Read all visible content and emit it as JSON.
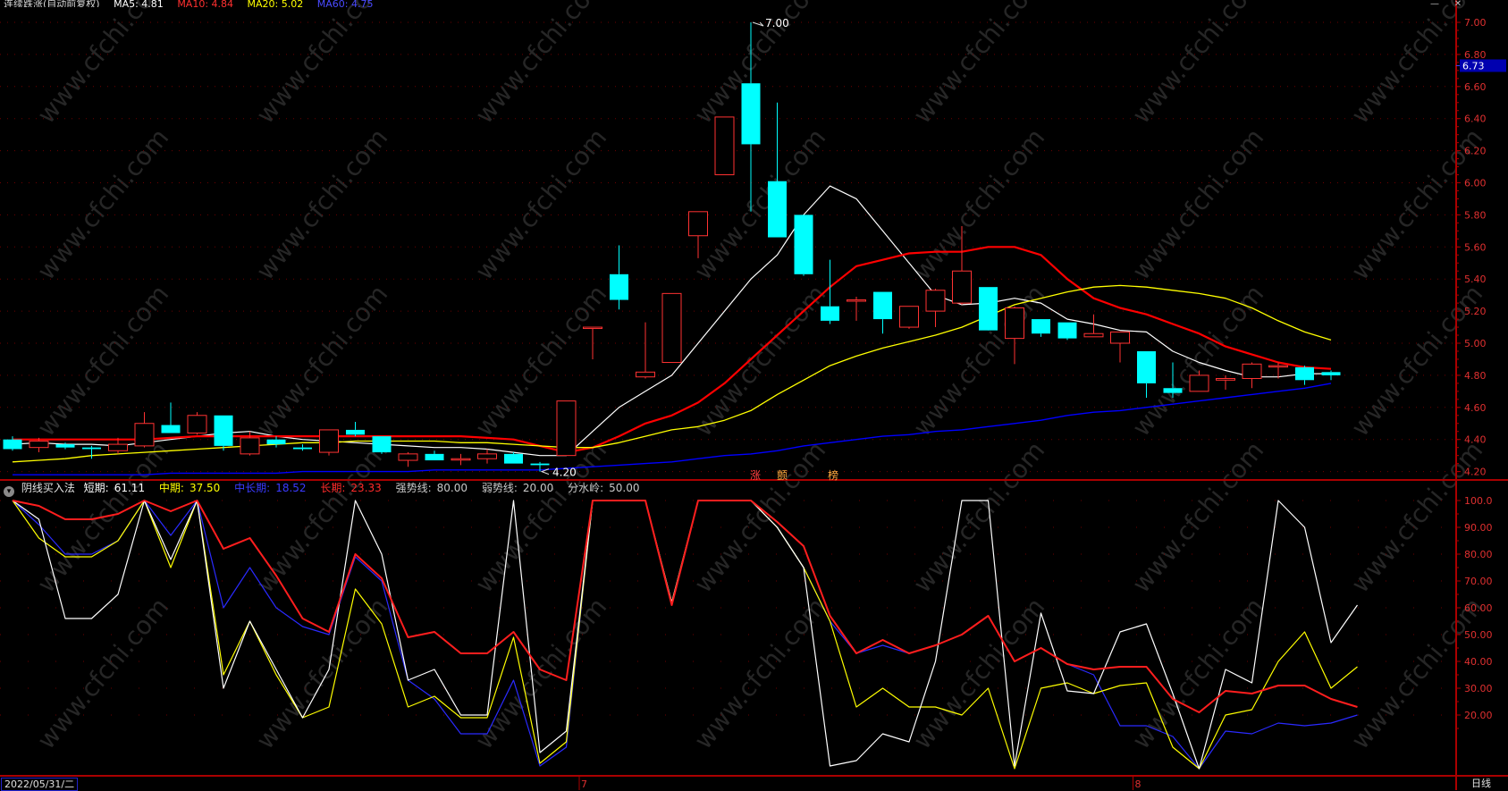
{
  "header": {
    "title": "连续跌涨(自动前复权)",
    "ma_labels": [
      "MA5: 4.81",
      "MA10: 4.84",
      "MA20: 5.02",
      "MA60: 4.75"
    ]
  },
  "window_controls": {
    "min": "—",
    "close": "✕"
  },
  "period_label": "日线",
  "current_date": "2022/05/31/二",
  "price_panel": {
    "current_price": "6.73",
    "high_label": "7.00",
    "low_label": "4.20",
    "marks": [
      "涨",
      "颤",
      "榜"
    ],
    "yticks": [
      "7.00",
      "6.80",
      "6.60",
      "6.40",
      "6.20",
      "6.00",
      "5.80",
      "5.60",
      "5.40",
      "5.20",
      "5.00",
      "4.80",
      "4.60",
      "4.40",
      "4.20"
    ]
  },
  "indicator_panel": {
    "name": "阴线买入法",
    "lines": [
      {
        "label": "短期:",
        "value": "61.11"
      },
      {
        "label": "中期:",
        "value": "37.50"
      },
      {
        "label": "中长期:",
        "value": "18.52"
      },
      {
        "label": "长期:",
        "value": "23.33"
      },
      {
        "label": "强势线:",
        "value": "80.00"
      },
      {
        "label": "弱势线:",
        "value": "20.00"
      },
      {
        "label": "分水岭:",
        "value": "50.00"
      }
    ],
    "yticks": [
      "100.0",
      "90.00",
      "80.00",
      "70.00",
      "60.00",
      "50.00",
      "40.00",
      "30.00",
      "20.00"
    ]
  },
  "x_axis": {
    "month_labels": [
      "7",
      "8"
    ]
  },
  "colors": {
    "bg": "#000000",
    "up": "#ff3232",
    "down": "#00ffff",
    "frame": "#aa0000",
    "grid": "#6e0000",
    "ma5": "#ffffff",
    "ma10": "#ff0000",
    "ma20": "#ffff00",
    "ma60": "#0000ff",
    "short": "#ffffff",
    "mid": "#ffff00",
    "midlong": "#2a2aff",
    "long": "#ff1e1e"
  },
  "chart_data": [
    {
      "type": "candlestick",
      "ylim": [
        4.15,
        7.05
      ],
      "candles": [
        {
          "o": 4.4,
          "h": 4.42,
          "l": 4.33,
          "c": 4.34
        },
        {
          "o": 4.35,
          "h": 4.41,
          "l": 4.32,
          "c": 4.39
        },
        {
          "o": 4.37,
          "h": 4.38,
          "l": 4.34,
          "c": 4.35
        },
        {
          "o": 4.35,
          "h": 4.36,
          "l": 4.28,
          "c": 4.34
        },
        {
          "o": 4.33,
          "h": 4.41,
          "l": 4.31,
          "c": 4.37
        },
        {
          "o": 4.36,
          "h": 4.57,
          "l": 4.35,
          "c": 4.5
        },
        {
          "o": 4.49,
          "h": 4.63,
          "l": 4.44,
          "c": 4.44
        },
        {
          "o": 4.44,
          "h": 4.57,
          "l": 4.43,
          "c": 4.55
        },
        {
          "o": 4.55,
          "h": 4.55,
          "l": 4.33,
          "c": 4.36
        },
        {
          "o": 4.31,
          "h": 4.45,
          "l": 4.3,
          "c": 4.41
        },
        {
          "o": 4.4,
          "h": 4.42,
          "l": 4.35,
          "c": 4.37
        },
        {
          "o": 4.35,
          "h": 4.37,
          "l": 4.33,
          "c": 4.34
        },
        {
          "o": 4.32,
          "h": 4.45,
          "l": 4.3,
          "c": 4.46
        },
        {
          "o": 4.46,
          "h": 4.51,
          "l": 4.42,
          "c": 4.43
        },
        {
          "o": 4.42,
          "h": 4.42,
          "l": 4.31,
          "c": 4.32
        },
        {
          "o": 4.27,
          "h": 4.32,
          "l": 4.23,
          "c": 4.31
        },
        {
          "o": 4.31,
          "h": 4.33,
          "l": 4.27,
          "c": 4.27
        },
        {
          "o": 4.28,
          "h": 4.31,
          "l": 4.24,
          "c": 4.28
        },
        {
          "o": 4.28,
          "h": 4.34,
          "l": 4.25,
          "c": 4.31
        },
        {
          "o": 4.31,
          "h": 4.32,
          "l": 4.25,
          "c": 4.25
        },
        {
          "o": 4.25,
          "h": 4.26,
          "l": 4.2,
          "c": 4.24
        },
        {
          "o": 4.3,
          "h": 4.64,
          "l": 4.3,
          "c": 4.64
        },
        {
          "o": 5.1,
          "h": 5.1,
          "l": 4.9,
          "c": 5.1
        },
        {
          "o": 5.43,
          "h": 5.61,
          "l": 5.21,
          "c": 5.27
        },
        {
          "o": 4.79,
          "h": 5.13,
          "l": 4.78,
          "c": 4.82
        },
        {
          "o": 4.88,
          "h": 5.31,
          "l": 4.88,
          "c": 5.31
        },
        {
          "o": 5.67,
          "h": 5.82,
          "l": 5.53,
          "c": 5.82
        },
        {
          "o": 6.05,
          "h": 6.41,
          "l": 6.05,
          "c": 6.41
        },
        {
          "o": 6.62,
          "h": 7.0,
          "l": 5.82,
          "c": 6.24
        },
        {
          "o": 6.01,
          "h": 6.5,
          "l": 5.66,
          "c": 5.66
        },
        {
          "o": 5.8,
          "h": 5.8,
          "l": 5.42,
          "c": 5.43
        },
        {
          "o": 5.23,
          "h": 5.52,
          "l": 5.12,
          "c": 5.14
        },
        {
          "o": 5.27,
          "h": 5.29,
          "l": 5.14,
          "c": 5.27
        },
        {
          "o": 5.32,
          "h": 5.32,
          "l": 5.06,
          "c": 5.15
        },
        {
          "o": 5.1,
          "h": 5.23,
          "l": 5.09,
          "c": 5.23
        },
        {
          "o": 5.2,
          "h": 5.34,
          "l": 5.1,
          "c": 5.33
        },
        {
          "o": 5.25,
          "h": 5.73,
          "l": 5.24,
          "c": 5.45
        },
        {
          "o": 5.35,
          "h": 5.35,
          "l": 5.09,
          "c": 5.08
        },
        {
          "o": 5.03,
          "h": 5.23,
          "l": 4.87,
          "c": 5.22
        },
        {
          "o": 5.15,
          "h": 5.15,
          "l": 5.04,
          "c": 5.06
        },
        {
          "o": 5.13,
          "h": 5.13,
          "l": 5.02,
          "c": 5.03
        },
        {
          "o": 5.04,
          "h": 5.18,
          "l": 5.04,
          "c": 5.06
        },
        {
          "o": 5.0,
          "h": 5.07,
          "l": 4.88,
          "c": 5.07
        },
        {
          "o": 4.95,
          "h": 4.95,
          "l": 4.66,
          "c": 4.75
        },
        {
          "o": 4.72,
          "h": 4.88,
          "l": 4.66,
          "c": 4.69
        },
        {
          "o": 4.7,
          "h": 4.83,
          "l": 4.7,
          "c": 4.8
        },
        {
          "o": 4.77,
          "h": 4.8,
          "l": 4.71,
          "c": 4.78
        },
        {
          "o": 4.78,
          "h": 4.88,
          "l": 4.72,
          "c": 4.87
        },
        {
          "o": 4.86,
          "h": 4.88,
          "l": 4.78,
          "c": 4.86
        },
        {
          "o": 4.85,
          "h": 4.86,
          "l": 4.74,
          "c": 4.77
        },
        {
          "o": 4.82,
          "h": 4.83,
          "l": 4.77,
          "c": 4.8
        }
      ],
      "series": [
        {
          "key": "ma5",
          "values": [
            4.37,
            4.38,
            4.37,
            4.37,
            4.36,
            4.38,
            4.4,
            4.42,
            4.44,
            4.45,
            4.42,
            4.4,
            4.39,
            4.38,
            4.37,
            4.36,
            4.35,
            4.35,
            4.34,
            4.32,
            4.3,
            4.3,
            4.45,
            4.6,
            4.7,
            4.8,
            5.0,
            5.2,
            5.4,
            5.55,
            5.8,
            5.98,
            5.9,
            5.7,
            5.5,
            5.3,
            5.24,
            5.25,
            5.28,
            5.25,
            5.15,
            5.12,
            5.08,
            5.07,
            4.95,
            4.88,
            4.83,
            4.79,
            4.79,
            4.81,
            4.81
          ]
        },
        {
          "key": "ma10",
          "values": [
            4.4,
            4.4,
            4.4,
            4.4,
            4.4,
            4.4,
            4.41,
            4.42,
            4.42,
            4.42,
            4.42,
            4.42,
            4.42,
            4.42,
            4.42,
            4.42,
            4.42,
            4.42,
            4.41,
            4.4,
            4.36,
            4.32,
            4.35,
            4.42,
            4.5,
            4.55,
            4.63,
            4.75,
            4.9,
            5.05,
            5.2,
            5.35,
            5.48,
            5.52,
            5.56,
            5.57,
            5.57,
            5.6,
            5.6,
            5.55,
            5.4,
            5.28,
            5.22,
            5.18,
            5.12,
            5.06,
            4.98,
            4.93,
            4.88,
            4.85,
            4.84
          ]
        },
        {
          "key": "ma20",
          "values": [
            4.26,
            4.27,
            4.28,
            4.3,
            4.31,
            4.32,
            4.33,
            4.34,
            4.35,
            4.36,
            4.37,
            4.38,
            4.38,
            4.39,
            4.39,
            4.39,
            4.39,
            4.38,
            4.38,
            4.37,
            4.36,
            4.35,
            4.35,
            4.38,
            4.42,
            4.46,
            4.48,
            4.52,
            4.58,
            4.68,
            4.77,
            4.86,
            4.92,
            4.97,
            5.01,
            5.05,
            5.1,
            5.17,
            5.24,
            5.28,
            5.32,
            5.35,
            5.36,
            5.35,
            5.33,
            5.31,
            5.28,
            5.22,
            5.14,
            5.07,
            5.02
          ]
        },
        {
          "key": "ma60",
          "values": [
            4.18,
            4.18,
            4.18,
            4.18,
            4.18,
            4.18,
            4.19,
            4.19,
            4.19,
            4.19,
            4.19,
            4.2,
            4.2,
            4.2,
            4.2,
            4.2,
            4.21,
            4.21,
            4.21,
            4.21,
            4.21,
            4.22,
            4.23,
            4.24,
            4.25,
            4.26,
            4.28,
            4.3,
            4.31,
            4.33,
            4.36,
            4.38,
            4.4,
            4.42,
            4.43,
            4.45,
            4.46,
            4.48,
            4.5,
            4.52,
            4.55,
            4.57,
            4.58,
            4.6,
            4.62,
            4.64,
            4.66,
            4.68,
            4.7,
            4.72,
            4.75
          ]
        }
      ]
    },
    {
      "type": "line",
      "ylim": [
        0,
        100
      ],
      "strong_line": 80,
      "weak_line": 20,
      "watershed": 50,
      "series": [
        {
          "key": "short",
          "values": [
            100,
            93,
            56,
            56,
            65,
            100,
            78,
            100,
            30,
            55,
            37,
            19,
            37,
            100,
            80,
            33,
            37,
            20,
            20,
            100,
            6,
            14,
            100,
            100,
            100,
            62,
            100,
            100,
            100,
            90,
            75,
            1,
            3,
            13,
            10,
            40,
            100,
            100,
            1,
            58,
            29,
            28,
            51,
            54,
            28,
            0,
            37,
            32,
            100,
            90,
            47,
            61
          ]
        },
        {
          "key": "mid",
          "values": [
            100,
            86,
            79,
            79,
            85,
            100,
            75,
            100,
            35,
            55,
            35,
            19,
            23,
            67,
            54,
            23,
            27,
            19,
            19,
            49,
            2,
            10,
            100,
            100,
            100,
            62,
            100,
            100,
            100,
            90,
            75,
            55,
            23,
            30,
            23,
            23,
            20,
            30,
            0,
            30,
            32,
            28,
            31,
            32,
            8,
            0,
            20,
            22,
            40,
            51,
            30,
            38
          ]
        },
        {
          "key": "midlong",
          "values": [
            100,
            91,
            80,
            80,
            85,
            100,
            87,
            100,
            60,
            75,
            60,
            53,
            50,
            79,
            70,
            33,
            26,
            13,
            13,
            33,
            1,
            8,
            100,
            100,
            100,
            61,
            100,
            100,
            100,
            90,
            75,
            55,
            43,
            46,
            43,
            46,
            50,
            57,
            40,
            45,
            39,
            35,
            16,
            16,
            12,
            0,
            14,
            13,
            17,
            16,
            17,
            20
          ]
        },
        {
          "key": "long",
          "values": [
            100,
            98,
            93,
            93,
            95,
            100,
            96,
            100,
            82,
            86,
            72,
            56,
            51,
            80,
            71,
            49,
            51,
            43,
            43,
            51,
            37,
            33,
            100,
            100,
            100,
            61,
            100,
            100,
            100,
            92,
            83,
            57,
            43,
            48,
            43,
            46,
            50,
            57,
            40,
            45,
            39,
            37,
            38,
            38,
            26,
            21,
            29,
            28,
            31,
            31,
            26,
            23
          ]
        }
      ]
    }
  ]
}
